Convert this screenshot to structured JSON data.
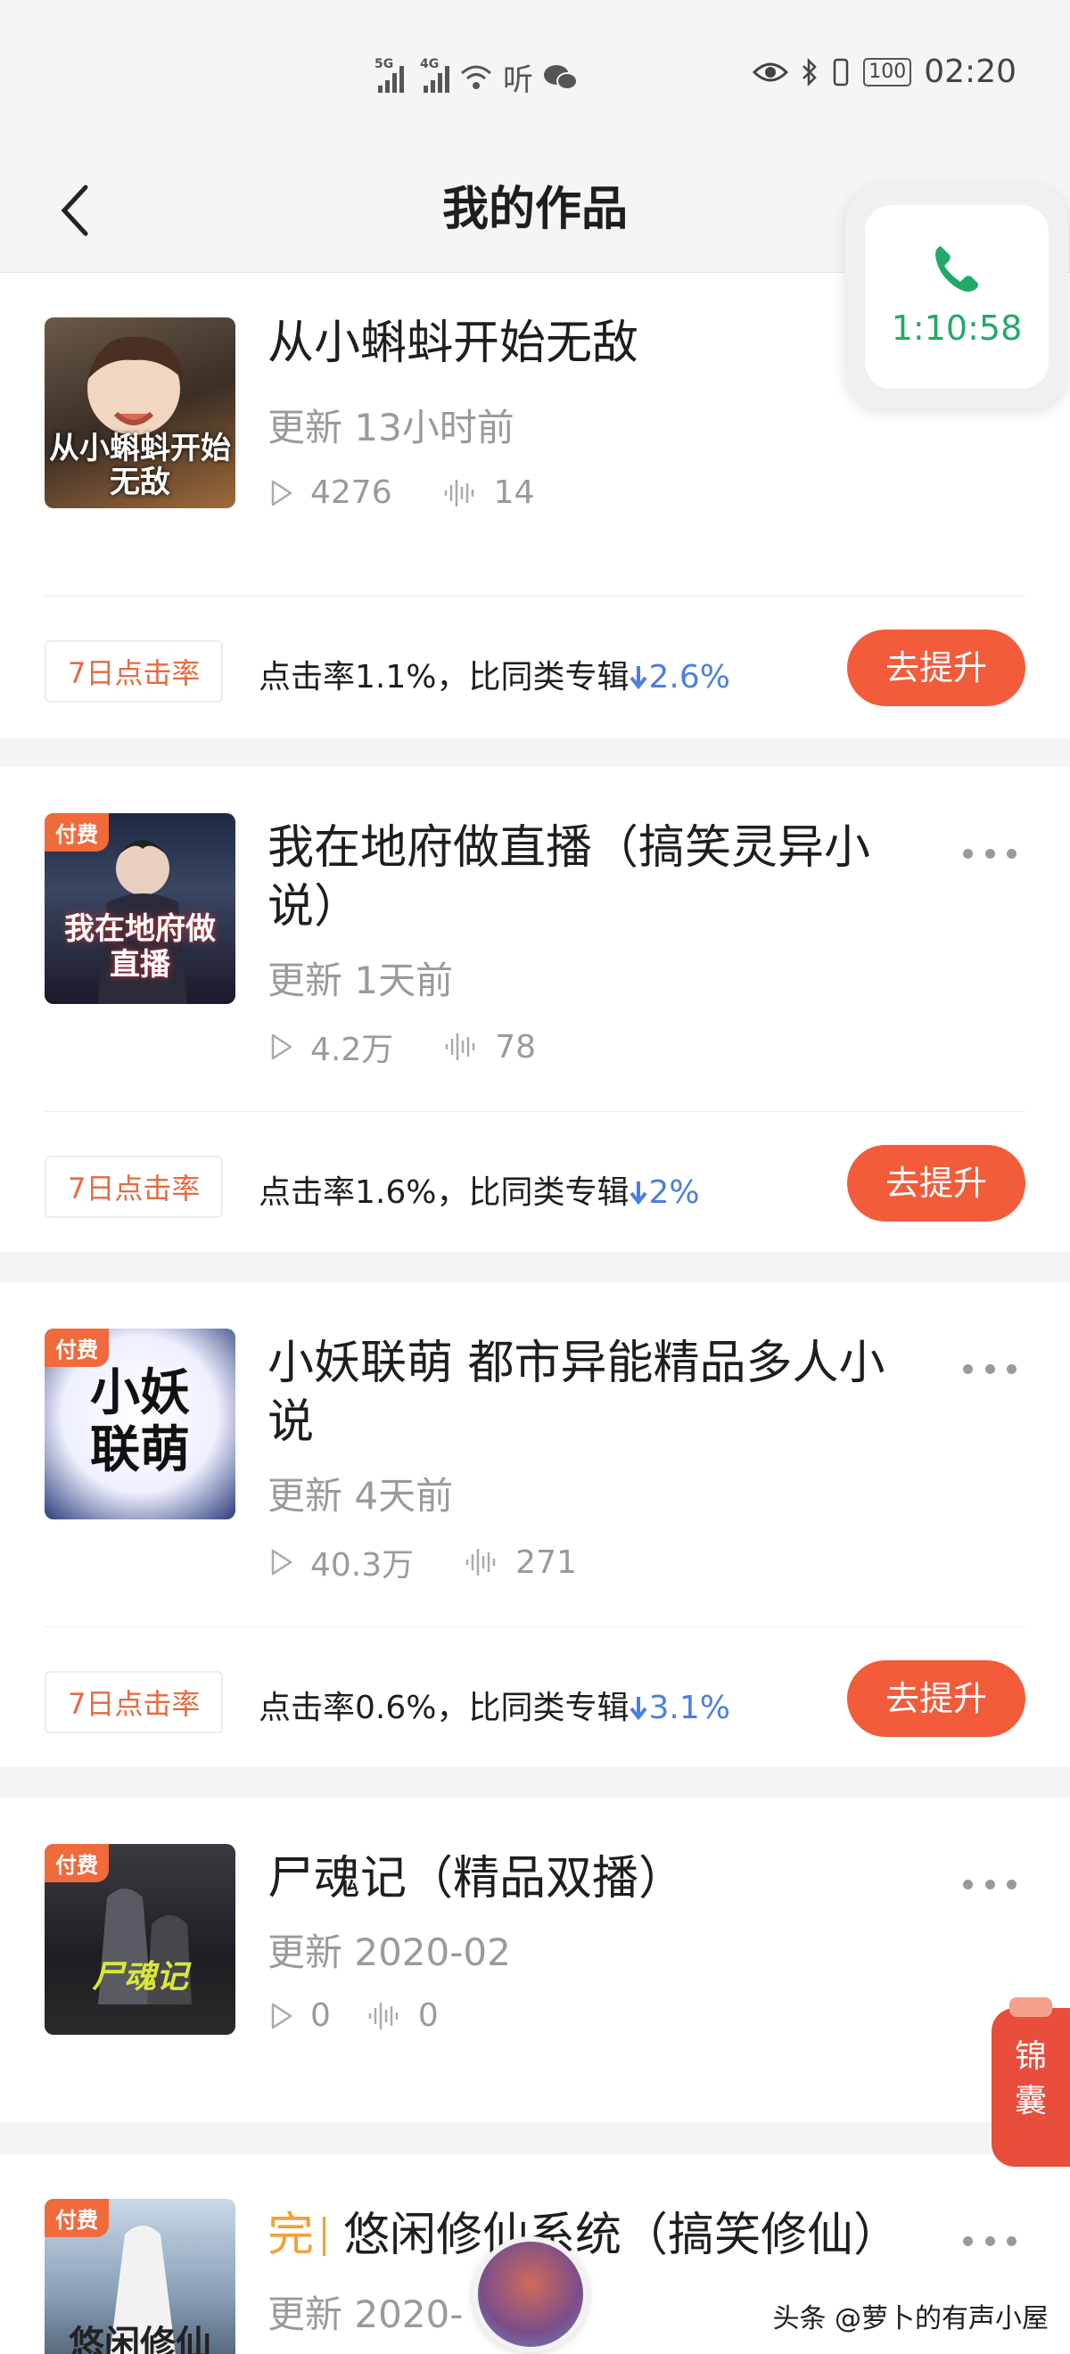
{
  "status_bar": {
    "net1": "5G",
    "net2": "4G",
    "extra_app": "听",
    "battery": "100",
    "time": "02:20"
  },
  "header": {
    "title": "我的作品"
  },
  "call": {
    "timer": "1:10:58"
  },
  "works": [
    {
      "title": "从小蝌蚪开始无敌",
      "paid": "",
      "update": "更新 13小时前",
      "plays": "4276",
      "tracks": "14",
      "cover_text": "从小蝌蚪开始无敌",
      "rate_tag": "7日点击率",
      "rate_text": "点击率1.1%，比同类专辑",
      "rate_diff": "2.6%",
      "boost": "去提升"
    },
    {
      "title": "我在地府做直播（搞笑灵异小说）",
      "paid": "付费",
      "update": "更新 1天前",
      "plays": "4.2万",
      "tracks": "78",
      "cover_text": "我在地府做直播",
      "rate_tag": "7日点击率",
      "rate_text": "点击率1.6%，比同类专辑",
      "rate_diff": "2%",
      "boost": "去提升"
    },
    {
      "title": "小妖联萌 都市异能精品多人小说",
      "paid": "付费",
      "update": "更新 4天前",
      "plays": "40.3万",
      "tracks": "271",
      "cover_text": "小妖联萌",
      "rate_tag": "7日点击率",
      "rate_text": "点击率0.6%，比同类专辑",
      "rate_diff": "3.1%",
      "boost": "去提升"
    },
    {
      "title": "尸魂记（精品双播）",
      "paid": "付费",
      "update": "更新 2020-02",
      "plays": "0",
      "tracks": "0",
      "cover_text": "尸魂记"
    },
    {
      "title": "悠闲修仙系统（搞笑修仙）",
      "paid": "付费",
      "complete": "完",
      "update": "更新 2020-",
      "cover_text": "悠闲修仙"
    }
  ],
  "side_widget": {
    "label": "锦囊"
  },
  "watermark": "头条 @萝卜的有声小屋"
}
